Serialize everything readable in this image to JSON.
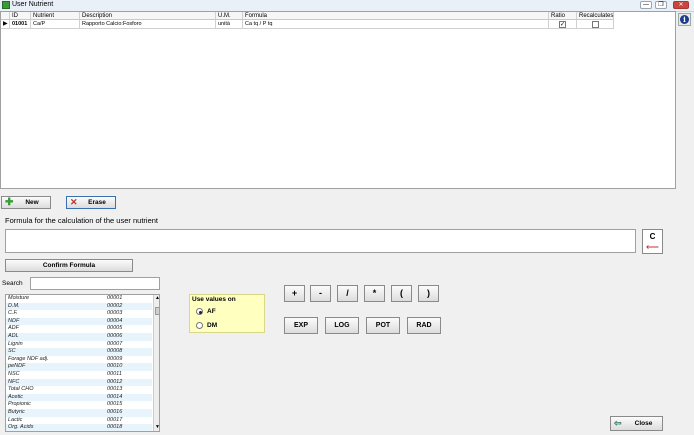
{
  "window": {
    "title": "User Nutrient",
    "btn_min": "—",
    "btn_max": "❐",
    "btn_close": "✕"
  },
  "grid": {
    "headers": {
      "id": "ID",
      "nutrient": "Nutrient",
      "description": "Description",
      "um": "U.M.",
      "formula": "Formula",
      "ratio": "Ratio",
      "recalculates": "Recalculates"
    },
    "row": {
      "id": "01001",
      "nutrient": "Ca/P",
      "description": "Rapporto Calcio:Fosforo",
      "um": "unità",
      "formula": "Ca tq / P tq",
      "ratio_checked": true,
      "recalculates_checked": false
    }
  },
  "buttons": {
    "new": "New",
    "erase": "Erase",
    "confirm": "Confirm Formula",
    "clear": "C",
    "close": "Close"
  },
  "formula_label": "Formula for the calculation of the user nutrient",
  "search": {
    "label": "Search"
  },
  "nutrients": [
    {
      "name": "Moisture",
      "code": "00001"
    },
    {
      "name": "D.M.",
      "code": "00002"
    },
    {
      "name": "C.F.",
      "code": "00003"
    },
    {
      "name": "NDF",
      "code": "00004"
    },
    {
      "name": "ADF",
      "code": "00005"
    },
    {
      "name": "ADL",
      "code": "00006"
    },
    {
      "name": "Lignin",
      "code": "00007"
    },
    {
      "name": "SC",
      "code": "00008"
    },
    {
      "name": "Forage NDF adj.",
      "code": "00009"
    },
    {
      "name": "peNDF",
      "code": "00010"
    },
    {
      "name": "NSC",
      "code": "00011"
    },
    {
      "name": "NFC",
      "code": "00012"
    },
    {
      "name": "Total CHO",
      "code": "00013"
    },
    {
      "name": "Acetic",
      "code": "00014"
    },
    {
      "name": "Propionic",
      "code": "00015"
    },
    {
      "name": "Butyric",
      "code": "00016"
    },
    {
      "name": "Lactic",
      "code": "00017"
    },
    {
      "name": "Org. Acids",
      "code": "00018"
    }
  ],
  "use_values": {
    "title": "Use values on",
    "options": [
      "AF",
      "DM"
    ],
    "selected": "AF"
  },
  "operators": [
    "+",
    "-",
    "/",
    "*",
    "(",
    ")"
  ],
  "functions": [
    "EXP",
    "LOG",
    "POT",
    "RAD"
  ],
  "colors": {
    "group_bg": "#ffffc0",
    "accent_green": "#3a9b3a",
    "erase_red": "#c03030"
  }
}
